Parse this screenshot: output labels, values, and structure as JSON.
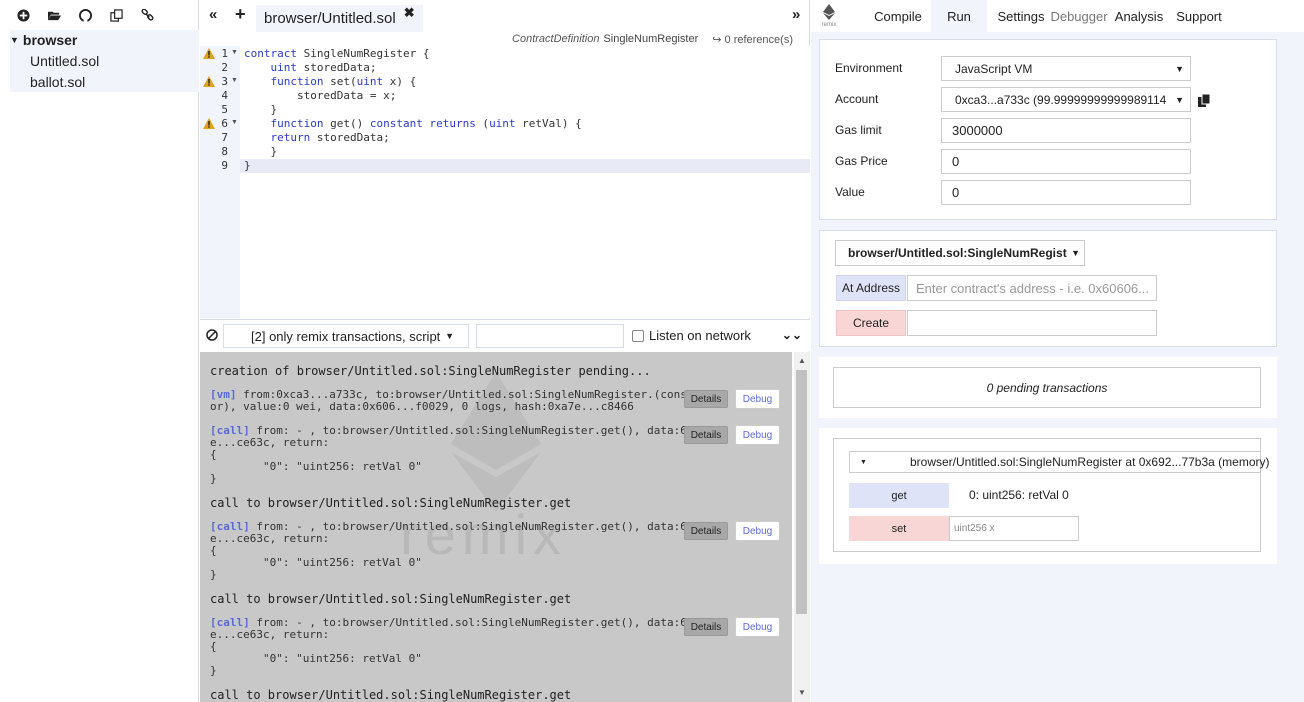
{
  "file_explorer": {
    "toolbar_icons": [
      "plus-icon",
      "folder-open-icon",
      "github-icon",
      "copy-icon",
      "link-icon"
    ],
    "root": "browser",
    "files": [
      "Untitled.sol",
      "ballot.sol"
    ]
  },
  "editor": {
    "nav_left": "«",
    "nav_plus": "+",
    "tab_label": "browser/Untitled.sol",
    "tab_close": "✖",
    "nav_right": "»",
    "info": {
      "kind": "ContractDefinition",
      "name": "SingleNumRegister",
      "refs": "0 reference(s)"
    },
    "line_numbers": [
      "1",
      "2",
      "3",
      "4",
      "5",
      "6",
      "7",
      "8",
      "9"
    ],
    "code": [
      "contract SingleNumRegister {",
      "    uint storedData;",
      "    function set(uint x) {",
      "        storedData = x;",
      "    }",
      "    function get() constant returns (uint retVal) {",
      "    return storedData;",
      "    }",
      "}"
    ]
  },
  "terminal": {
    "filter_label": "[2] only remix transactions, script",
    "listen_label": "Listen on network",
    "watermark": "remix",
    "entries": [
      {
        "l1": "creation of browser/Untitled.sol:SingleNumRegister pending..."
      },
      {
        "tag": "[vm]",
        "l1": " from:0xca3...a733c, to:browser/Untitled.sol:SingleNumRegister.(construct",
        "l2": "or), value:0 wei, data:0x606...f0029, 0 logs, hash:0xa7e...c8466"
      },
      {
        "tag": "[call]",
        "l1": " from: - , to:browser/Untitled.sol:SingleNumRegister.get(), data:6d4c",
        "l2": "e...ce63c, return:",
        "l3": "{",
        "l4": "        \"0\": \"uint256: retVal 0\"",
        "l5": "}"
      },
      {
        "l1": "call to browser/Untitled.sol:SingleNumRegister.get"
      },
      {
        "tag": "[call]",
        "l1": " from: - , to:browser/Untitled.sol:SingleNumRegister.get(), data:6d4c",
        "l2": "e...ce63c, return:",
        "l3": "{",
        "l4": "        \"0\": \"uint256: retVal 0\"",
        "l5": "}"
      },
      {
        "l1": "call to browser/Untitled.sol:SingleNumRegister.get"
      },
      {
        "tag": "[call]",
        "l1": " from: - , to:browser/Untitled.sol:SingleNumRegister.get(), data:6d4c",
        "l2": "e...ce63c, return:",
        "l3": "{",
        "l4": "        \"0\": \"uint256: retVal 0\"",
        "l5": "}"
      },
      {
        "l1": "call to browser/Untitled.sol:SingleNumRegister.get"
      }
    ],
    "details_label": "Details",
    "debug_label": "Debug"
  },
  "right_panel": {
    "logo_text": "remix",
    "tabs": [
      "Compile",
      "Run",
      "Settings",
      "Debugger",
      "Analysis",
      "Support"
    ],
    "active_tab": "Run",
    "environment": {
      "label": "Environment",
      "value": "JavaScript VM"
    },
    "account": {
      "label": "Account",
      "value": "0xca3...a733c (99.99999999999989114"
    },
    "gas_limit": {
      "label": "Gas limit",
      "value": "3000000"
    },
    "gas_price": {
      "label": "Gas Price",
      "value": "0"
    },
    "value": {
      "label": "Value",
      "value": "0"
    },
    "contract_select": "browser/Untitled.sol:SingleNumRegister",
    "at_address_label": "At Address",
    "at_address_placeholder": "Enter contract's address - i.e. 0x60606...",
    "create_label": "Create",
    "pending": "0 pending transactions",
    "instance_title": "browser/Untitled.sol:SingleNumRegister at 0x692...77b3a (memory)",
    "get_label": "get",
    "get_result": "0: uint256: retVal 0",
    "set_label": "set",
    "set_placeholder": "uint256 x"
  }
}
